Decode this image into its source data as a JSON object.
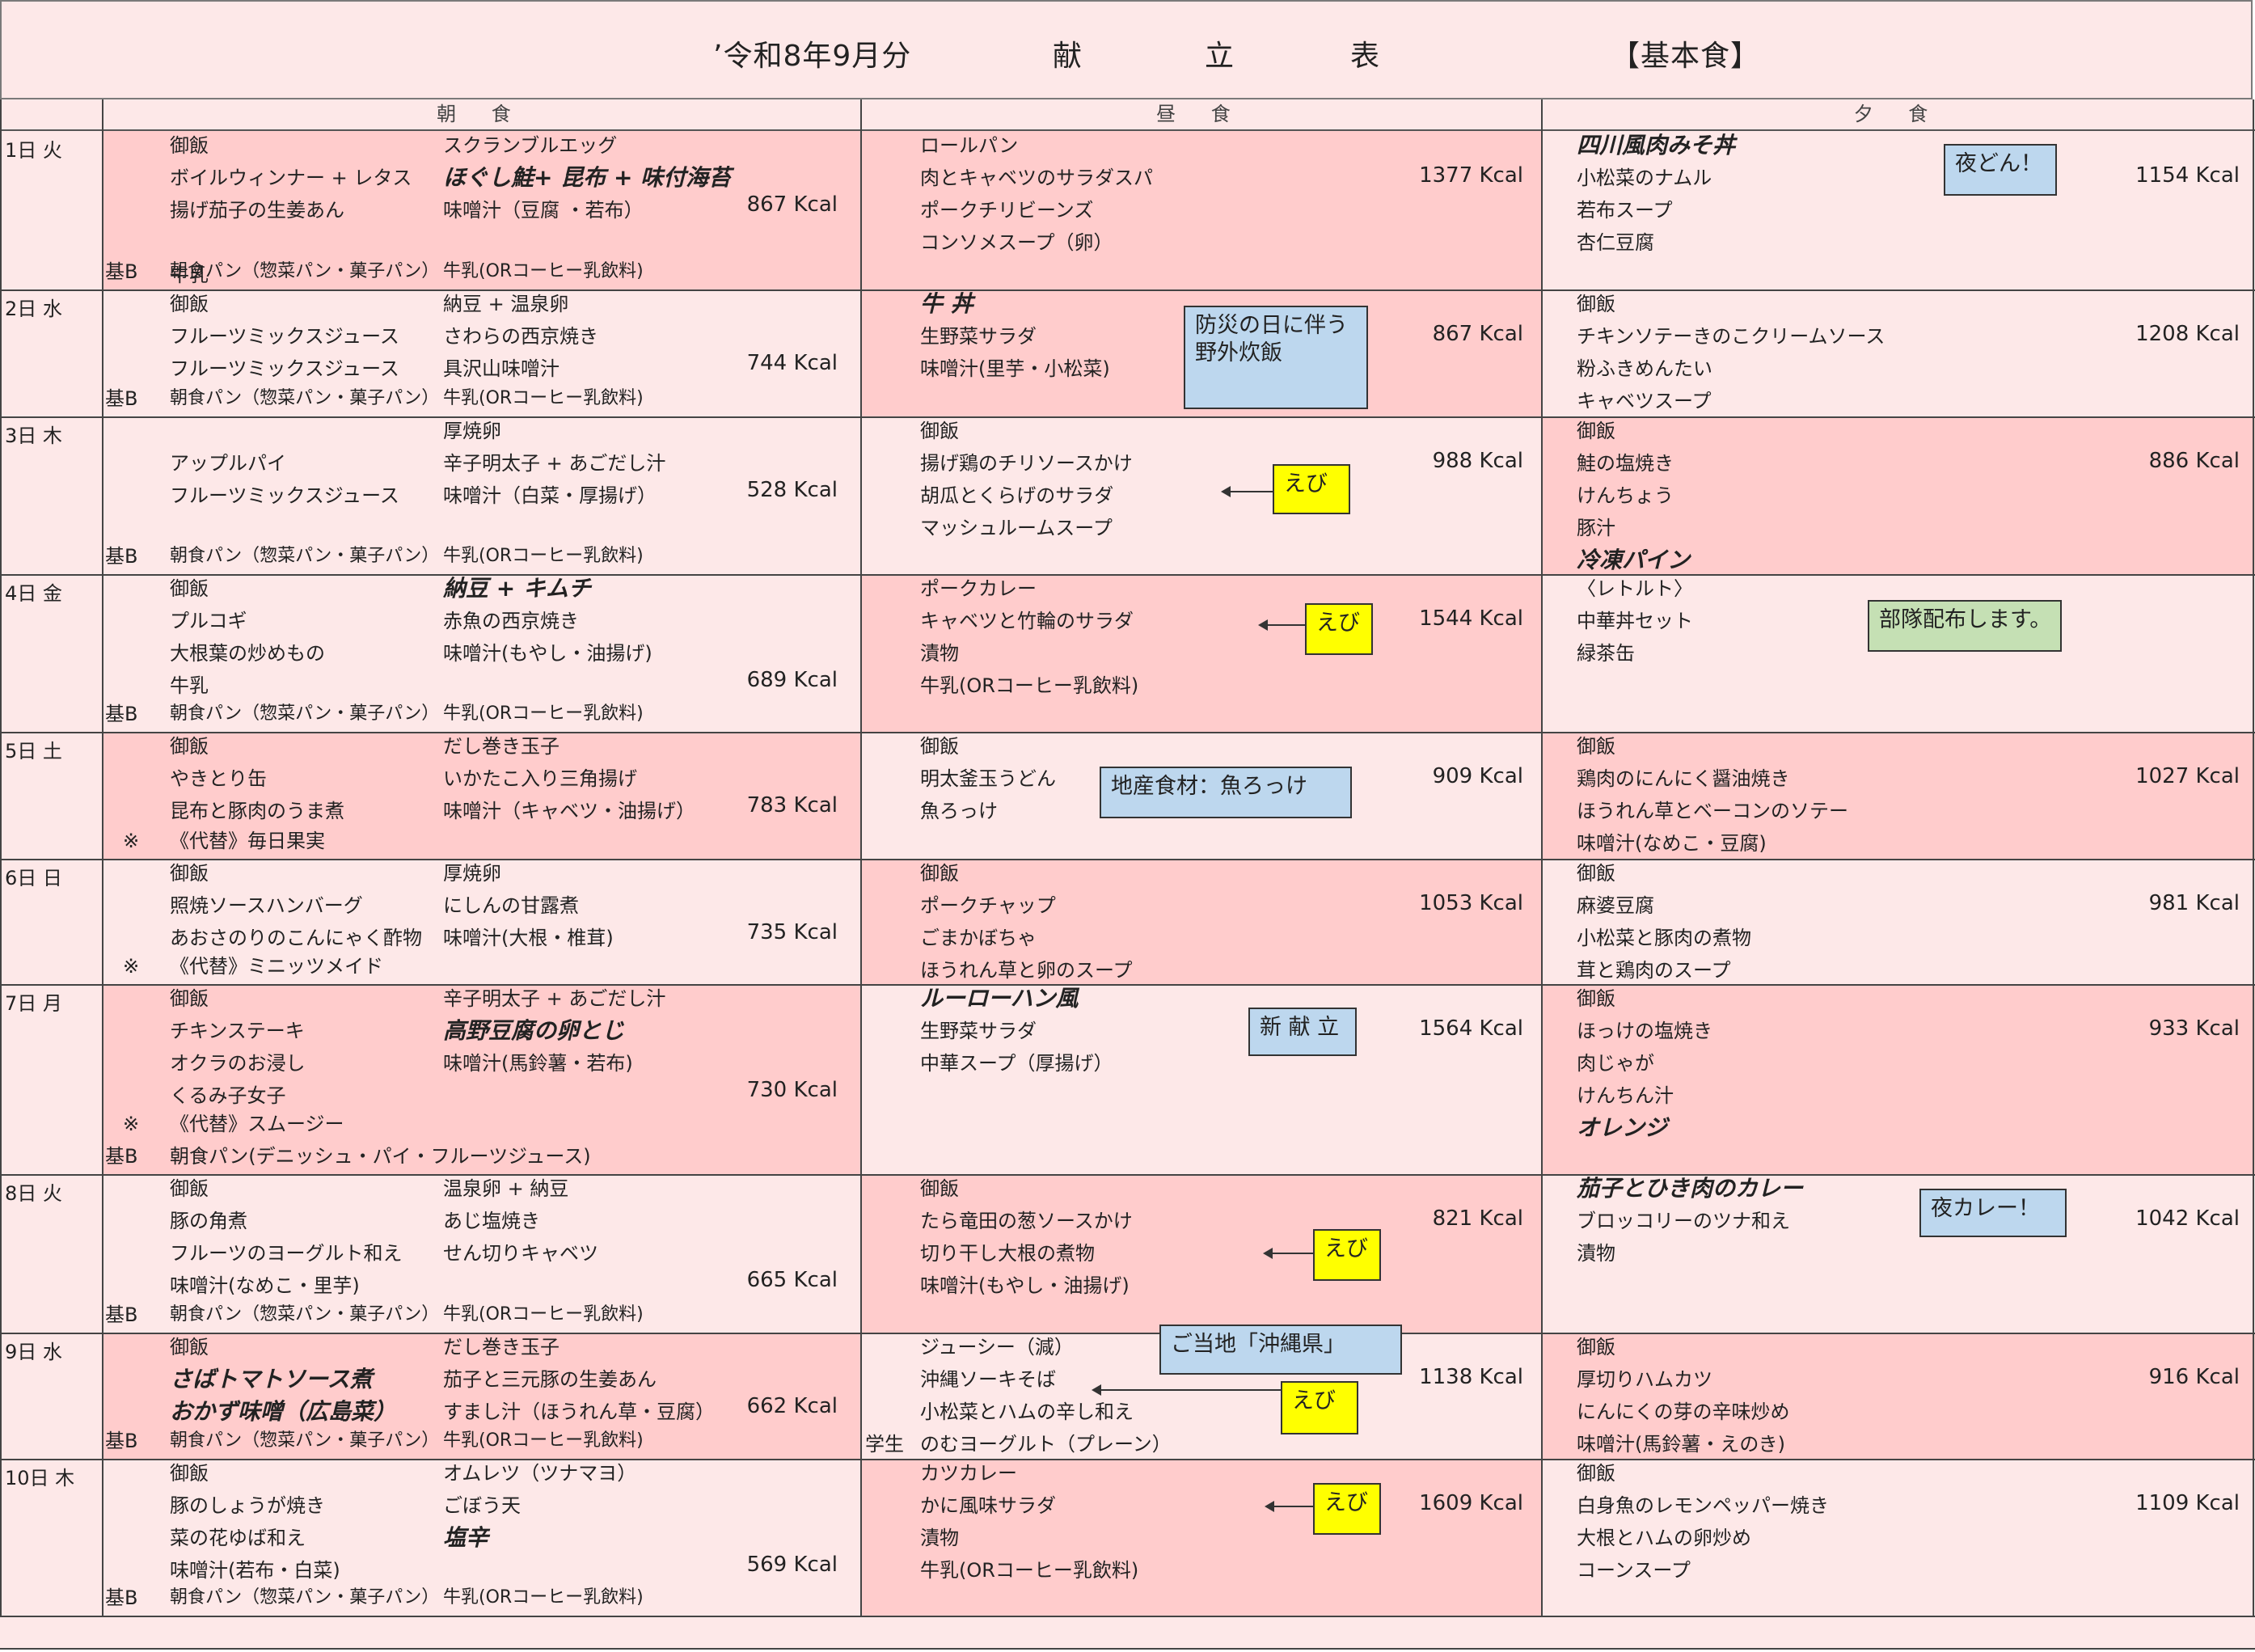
{
  "header": {
    "period": "’令和8年9月分",
    "t1": "献",
    "t2": "立",
    "t3": "表",
    "type": "【基本食】"
  },
  "columns": {
    "breakfast": "朝 食",
    "lunch": "昼 食",
    "dinner": "夕 食"
  },
  "colors": {
    "pink": "#ffcccc",
    "light": "#fde8e8",
    "yellow": "#ffff00",
    "blue": "#bdd7ee",
    "green": "#c5e0b4"
  },
  "rows": [
    {
      "day": "1日 火",
      "b": {
        "a": [
          "御飯",
          "ボイルウィンナー + レタス",
          "揚げ茄子の生姜あん",
          "",
          "牛乳"
        ],
        "b": [
          "スクランブルエッグ",
          "ほぐし鮭+ 昆布 + 味付海苔",
          "味噌汁（豆腐 ・若布）"
        ],
        "kcal": "867 Kcal",
        "mark": "基B",
        "pan": "朝食パン（惣菜パン・菓子パン）",
        "milk": "牛乳(ORコーヒー乳飲料)"
      },
      "l": {
        "items": [
          "ロールパン",
          "肉とキャベツのサラダスパ",
          "ポークチリビーンズ",
          "コンソメスープ（卵）"
        ],
        "kcal": "1377 Kcal"
      },
      "d": {
        "items": [
          "四川風肉みそ丼",
          "小松菜のナムル",
          "若布スープ",
          "杏仁豆腐"
        ],
        "kcal": "1154 Kcal"
      }
    },
    {
      "day": "2日 水",
      "b": {
        "a": [
          "御飯",
          "フルーツミックスジュース",
          "フルーツミックスジュース"
        ],
        "b": [
          "納豆 + 温泉卵",
          "さわらの西京焼き",
          "具沢山味噌汁"
        ],
        "kcal": "744 Kcal",
        "mark": "基B",
        "pan": "朝食パン（惣菜パン・菓子パン）",
        "milk": "牛乳(ORコーヒー乳飲料)"
      },
      "l": {
        "items": [
          "牛 丼",
          "生野菜サラダ",
          "味噌汁(里芋・小松菜)"
        ],
        "kcal": "867 Kcal"
      },
      "d": {
        "items": [
          "御飯",
          "チキンソテーきのこクリームソース",
          "粉ふきめんたい",
          "キャベツスープ"
        ],
        "kcal": "1208 Kcal"
      }
    },
    {
      "day": "3日 木",
      "b": {
        "a": [
          "",
          "アップルパイ",
          "フルーツミックスジュース"
        ],
        "b": [
          "厚焼卵",
          "辛子明太子 + あごだし汁",
          "味噌汁（白菜・厚揚げ）"
        ],
        "kcal": "528 Kcal",
        "mark": "基B",
        "pan": "朝食パン（惣菜パン・菓子パン）",
        "milk": "牛乳(ORコーヒー乳飲料)"
      },
      "l": {
        "items": [
          "御飯",
          "揚げ鶏のチリソースかけ",
          "胡瓜とくらげのサラダ",
          "マッシュルームスープ"
        ],
        "kcal": "988 Kcal"
      },
      "d": {
        "items": [
          "御飯",
          "鮭の塩焼き",
          "けんちょう",
          "豚汁",
          "冷凍パイン"
        ],
        "kcal": "886 Kcal"
      }
    },
    {
      "day": "4日 金",
      "b": {
        "a": [
          "御飯",
          "プルコギ",
          "大根葉の炒めもの",
          "牛乳"
        ],
        "b": [
          "納豆 + キムチ",
          "赤魚の西京焼き",
          "味噌汁(もやし・油揚げ)"
        ],
        "kcal": "689 Kcal",
        "mark": "基B",
        "pan": "朝食パン（惣菜パン・菓子パン）",
        "milk": "牛乳(ORコーヒー乳飲料)"
      },
      "l": {
        "items": [
          "ポークカレー",
          "キャベツと竹輪のサラダ",
          "漬物",
          "牛乳(ORコーヒー乳飲料)"
        ],
        "kcal": "1544 Kcal"
      },
      "d": {
        "items": [
          "〈レトルト〉",
          "中華丼セット",
          "緑茶缶"
        ],
        "kcal": ""
      }
    },
    {
      "day": "5日 土",
      "b": {
        "a": [
          "御飯",
          "やきとり缶",
          "昆布と豚肉のうま煮"
        ],
        "b": [
          "だし巻き玉子",
          "いかたこ入り三角揚げ",
          "味噌汁（キャベツ・油揚げ）"
        ],
        "kcal": "783 Kcal",
        "mark": "※",
        "pan": "《代替》毎日果実",
        "milk": ""
      },
      "l": {
        "items": [
          "御飯",
          "明太釜玉うどん",
          "魚ろっけ"
        ],
        "kcal": "909 Kcal"
      },
      "d": {
        "items": [
          "御飯",
          "鶏肉のにんにく醤油焼き",
          "ほうれん草とベーコンのソテー",
          "味噌汁(なめこ・豆腐)"
        ],
        "kcal": "1027 Kcal"
      }
    },
    {
      "day": "6日 日",
      "b": {
        "a": [
          "御飯",
          "照焼ソースハンバーグ",
          "あおさのりのこんにゃく酢物"
        ],
        "b": [
          "厚焼卵",
          "にしんの甘露煮",
          "味噌汁(大根・椎茸)"
        ],
        "kcal": "735 Kcal",
        "mark": "※",
        "pan": "《代替》ミニッツメイド",
        "milk": ""
      },
      "l": {
        "items": [
          "御飯",
          "ポークチャップ",
          "ごまかぼちゃ",
          "ほうれん草と卵のスープ"
        ],
        "kcal": "1053 Kcal"
      },
      "d": {
        "items": [
          "御飯",
          "麻婆豆腐",
          "小松菜と豚肉の煮物",
          "茸と鶏肉のスープ"
        ],
        "kcal": "981 Kcal"
      }
    },
    {
      "day": "7日 月",
      "b": {
        "a": [
          "御飯",
          "チキンステーキ",
          "オクラのお浸し",
          "くるみ子女子"
        ],
        "b": [
          "辛子明太子 + あごだし汁",
          "高野豆腐の卵とじ",
          "味噌汁(馬鈴薯・若布)"
        ],
        "kcal": "730 Kcal",
        "mark": "※",
        "pan": "《代替》スムージー",
        "mark2": "基B",
        "pan2": "朝食パン(デニッシュ・パイ・フルーツジュース)",
        "milk": ""
      },
      "l": {
        "items": [
          "ルーローハン風",
          "生野菜サラダ",
          "中華スープ（厚揚げ）"
        ],
        "kcal": "1564 Kcal"
      },
      "d": {
        "items": [
          "御飯",
          "ほっけの塩焼き",
          "肉じゃが",
          "けんちん汁",
          "オレンジ"
        ],
        "kcal": "933 Kcal"
      }
    },
    {
      "day": "8日 火",
      "b": {
        "a": [
          "御飯",
          "豚の角煮",
          "フルーツのヨーグルト和え",
          "味噌汁(なめこ・里芋)"
        ],
        "b": [
          "温泉卵 + 納豆",
          "あじ塩焼き",
          "せん切りキャベツ"
        ],
        "kcal": "665 Kcal",
        "mark": "基B",
        "pan": "朝食パン（惣菜パン・菓子パン）",
        "milk": "牛乳(ORコーヒー乳飲料)"
      },
      "l": {
        "items": [
          "御飯",
          "たら竜田の葱ソースかけ",
          "切り干し大根の煮物",
          "味噌汁(もやし・油揚げ)"
        ],
        "kcal": "821 Kcal"
      },
      "d": {
        "items": [
          "茄子とひき肉のカレー",
          "ブロッコリーのツナ和え",
          "漬物"
        ],
        "kcal": "1042 Kcal"
      }
    },
    {
      "day": "9日 水",
      "b": {
        "a": [
          "御飯",
          "さばトマトソース煮",
          "おかず味噌（広島菜）"
        ],
        "b": [
          "だし巻き玉子",
          "茄子と三元豚の生姜あん",
          "すまし汁（ほうれん草・豆腐）"
        ],
        "kcal": "662 Kcal",
        "mark": "基B",
        "pan": "朝食パン（惣菜パン・菓子パン）",
        "milk": "牛乳(ORコーヒー乳飲料)"
      },
      "l": {
        "items": [
          "ジューシー（減）",
          "沖縄ソーキそば",
          "小松菜とハムの辛し和え",
          "のむヨーグルト（プレーン）"
        ],
        "mark": "学生",
        "kcal": "1138 Kcal"
      },
      "d": {
        "items": [
          "御飯",
          "厚切りハムカツ",
          "にんにくの芽の辛味炒め",
          "味噌汁(馬鈴薯・えのき)"
        ],
        "kcal": "916 Kcal"
      }
    },
    {
      "day": "10日 木",
      "b": {
        "a": [
          "御飯",
          "豚のしょうが焼き",
          "菜の花ゆば和え",
          "味噌汁(若布・白菜)"
        ],
        "b": [
          "オムレツ（ツナマヨ）",
          "ごぼう天",
          "塩辛"
        ],
        "kcal": "569 Kcal",
        "mark": "基B",
        "pan": "朝食パン（惣菜パン・菓子パン）",
        "milk": "牛乳(ORコーヒー乳飲料)"
      },
      "l": {
        "items": [
          "カツカレー",
          "かに風味サラダ",
          "漬物",
          "牛乳(ORコーヒー乳飲料)"
        ],
        "kcal": "1609 Kcal"
      },
      "d": {
        "items": [
          "御飯",
          "白身魚のレモンペッパー焼き",
          "大根とハムの卵炒め",
          "コーンスープ"
        ],
        "kcal": "1109 Kcal"
      }
    }
  ],
  "notes": {
    "yoru_don": "夜どん！",
    "bousai": "防災の日に伴う\n野外炊飯",
    "ebi": "えび",
    "butai": "部隊配布します。",
    "chisan": "地産食材：魚ろっけ",
    "shin": "新 献 立",
    "yoru_curry": "夜カレー！",
    "gotochi": "ご当地「沖縄県」"
  }
}
